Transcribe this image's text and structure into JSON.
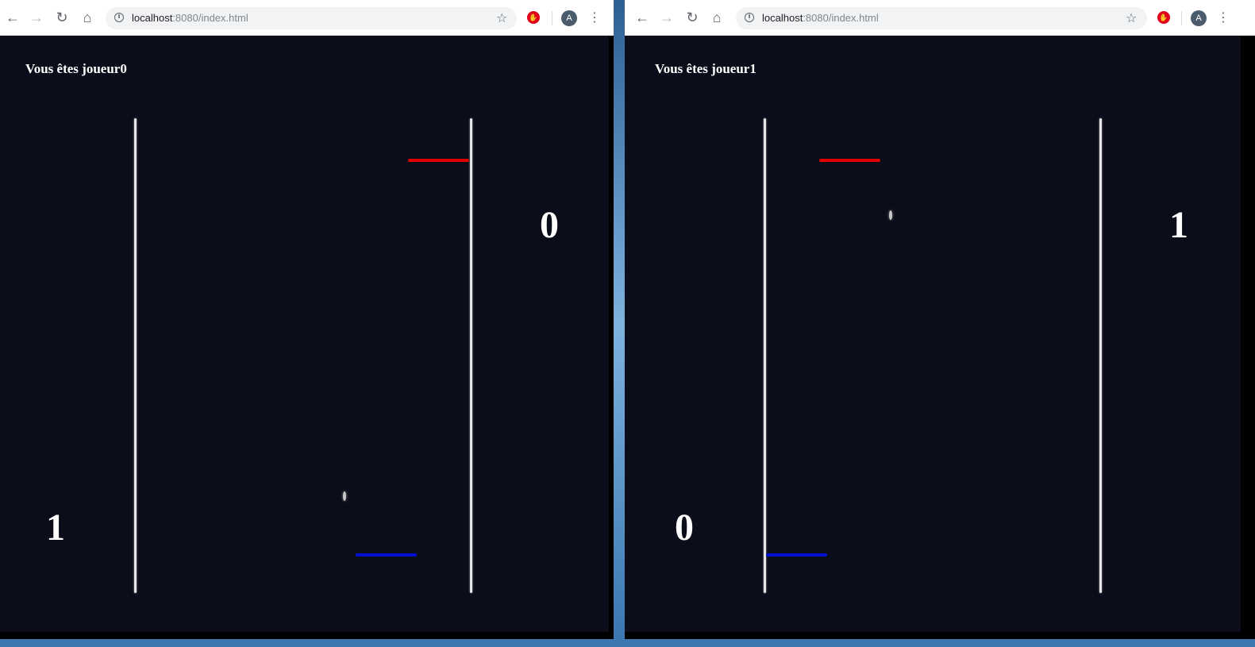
{
  "colors": {
    "red_paddle": "#e00000",
    "blue_paddle": "#0010d0",
    "court": "#0c0d1b",
    "wall": "#e6e6e6"
  },
  "windows": [
    {
      "browser": {
        "url_host": "localhost",
        "url_path": ":8080/index.html",
        "avatar_letter": "A"
      },
      "game": {
        "player_label": "Vous êtes joueur0",
        "score_left": "1",
        "score_right": "0"
      }
    },
    {
      "browser": {
        "url_host": "localhost",
        "url_path": ":8080/index.html",
        "avatar_letter": "A"
      },
      "game": {
        "player_label": "Vous êtes joueur1",
        "score_left": "0",
        "score_right": "1"
      }
    }
  ]
}
